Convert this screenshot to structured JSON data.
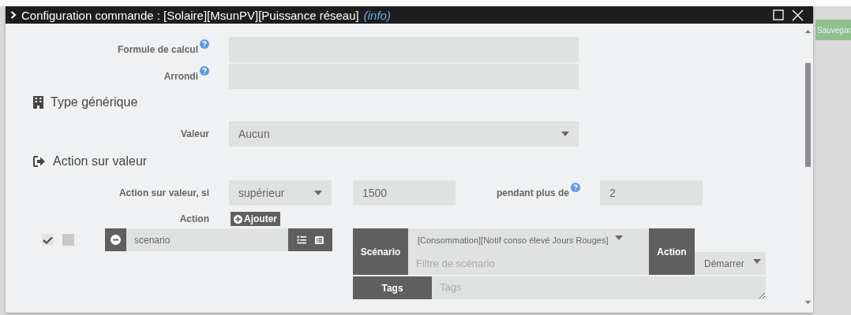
{
  "background": {
    "save_button": "Sauvegar"
  },
  "window": {
    "title": "Configuration commande : [Solaire][MsunPV][Puissance réseau]",
    "title_note": "(info)"
  },
  "fields": [
    {
      "label": "Formule de calcul",
      "help": true
    },
    {
      "label": "Arrondi",
      "help": true
    }
  ],
  "generic_type": {
    "heading": "Type générique",
    "label": "Valeur",
    "value": "Aucun"
  },
  "value_action": {
    "heading": "Action sur valeur",
    "condition_label": "Action sur valeur, si",
    "operator": "supérieur",
    "threshold": "1500",
    "duration_label": "pendant plus de",
    "duration_help": true,
    "duration": "2",
    "action_label": "Action",
    "add_button": "Ajouter",
    "actions": [
      {
        "checkboxes": [
          {
            "checked": true
          },
          {
            "checked": false
          }
        ],
        "type": "scenario",
        "scenario_label": "Scénario",
        "scenario": "[Consommation][Notif conso élevé Jours Rouges]",
        "filter_placeholder": "Filtre de scénario",
        "action_label": "Action",
        "action": "Démarrer",
        "tags_label": "Tags",
        "tags_placeholder": "Tags"
      }
    ]
  }
}
